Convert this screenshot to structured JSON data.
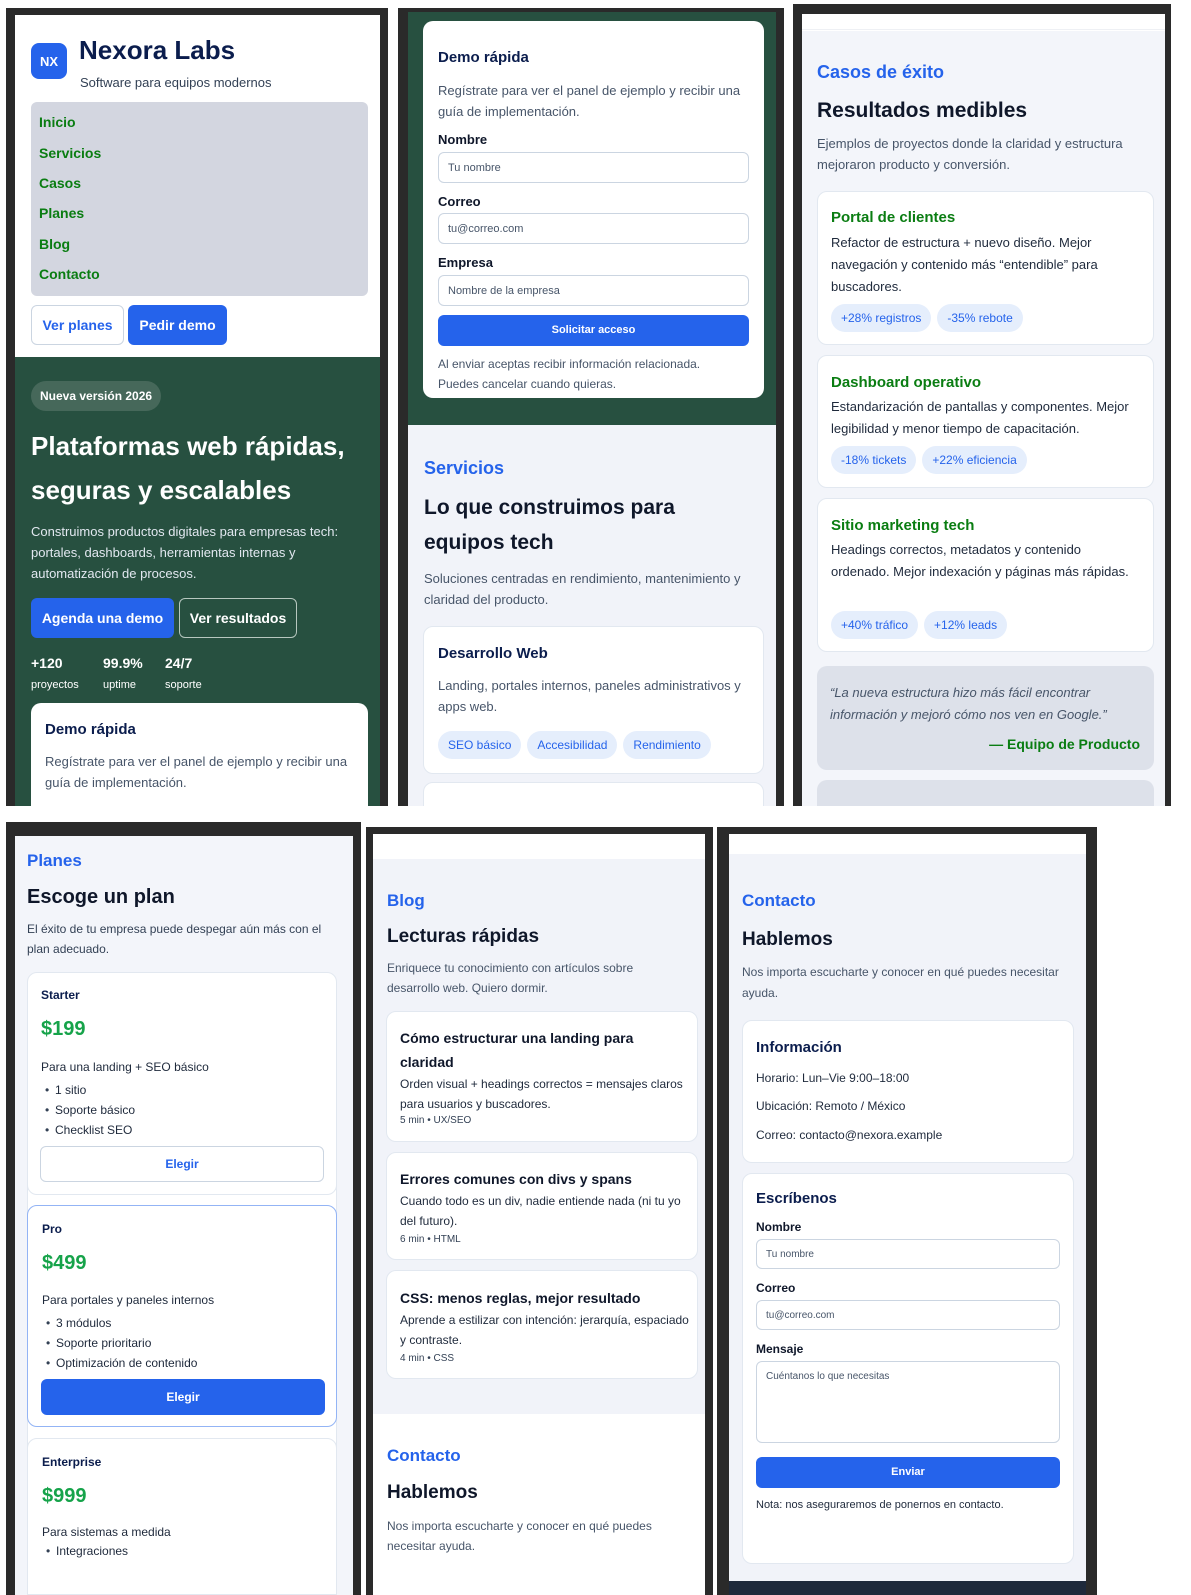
{
  "brand": {
    "badge": "NX",
    "name": "Nexora Labs",
    "tagline": "Software para equipos modernos"
  },
  "nav": [
    "Inicio",
    "Servicios",
    "Casos",
    "Planes",
    "Blog",
    "Contacto"
  ],
  "header_buttons": {
    "plans": "Ver planes",
    "demo": "Pedir demo"
  },
  "hero": {
    "badge": "Nueva versión 2026",
    "title_line1": "Plataformas web rápidas,",
    "title_line2": "seguras y escalables",
    "desc": "Construimos productos digitales para empresas tech: portales, dashboards, herramientas internas y automatización de procesos.",
    "cta_primary": "Agenda una demo",
    "cta_secondary": "Ver resultados",
    "stats": [
      {
        "value": "+120",
        "label": "proyectos"
      },
      {
        "value": "99.9%",
        "label": "uptime"
      },
      {
        "value": "24/7",
        "label": "soporte"
      }
    ]
  },
  "demo": {
    "title": "Demo rápida",
    "desc": "Regístrate para ver el panel de ejemplo y recibir una guía de implementación.",
    "name_label": "Nombre",
    "name_placeholder": "Tu nombre",
    "email_label": "Correo",
    "email_placeholder": "tu@correo.com",
    "company_label": "Empresa",
    "company_placeholder": "Nombre de la empresa",
    "submit": "Solicitar acceso",
    "note": "Al enviar aceptas recibir información relacionada. Puedes cancelar cuando quieras."
  },
  "services": {
    "eyebrow": "Servicios",
    "title_line1": "Lo que construimos para",
    "title_line2": "equipos tech",
    "desc": "Soluciones centradas en rendimiento, mantenimiento y claridad del producto.",
    "card": {
      "title": "Desarrollo Web",
      "desc": "Landing, portales internos, paneles administrativos y apps web.",
      "tags": [
        "SEO básico",
        "Accesibilidad",
        "Rendimiento"
      ]
    }
  },
  "cases": {
    "eyebrow": "Casos de éxito",
    "title": "Resultados medibles",
    "desc": "Ejemplos de proyectos donde la claridad y estructura mejoraron producto y conversión.",
    "items": [
      {
        "title": "Portal de clientes",
        "desc": "Refactor de estructura + nuevo diseño. Mejor navegación y contenido más “entendible” para buscadores.",
        "chips": [
          "+28% registros",
          "-35% rebote"
        ]
      },
      {
        "title": "Dashboard operativo",
        "desc": "Estandarización de pantallas y componentes. Mejor legibilidad y menor tiempo de capacitación.",
        "chips": [
          "-18% tickets",
          "+22% eficiencia"
        ]
      },
      {
        "title": "Sitio marketing tech",
        "desc": "Headings correctos, metadatos y contenido ordenado. Mejor indexación y páginas más rápidas.",
        "chips": [
          "+40% tráfico",
          "+12% leads"
        ]
      }
    ],
    "quote": "“La nueva estructura hizo más fácil encontrar información y mejoró cómo nos ven en Google.”",
    "quote_author": "— Equipo de Producto"
  },
  "plans": {
    "eyebrow": "Planes",
    "title": "Escoge un plan",
    "desc": "El éxito de tu empresa puede despegar aún más con el plan adecuado.",
    "items": [
      {
        "name": "Starter",
        "price": "$199",
        "desc": "Para una landing + SEO básico",
        "features": [
          "1 sitio",
          "Soporte básico",
          "Checklist SEO"
        ],
        "cta": "Elegir"
      },
      {
        "name": "Pro",
        "price": "$499",
        "desc": "Para portales y paneles internos",
        "features": [
          "3 módulos",
          "Soporte prioritario",
          "Optimización de contenido"
        ],
        "cta": "Elegir"
      },
      {
        "name": "Enterprise",
        "price": "$999",
        "desc": "Para sistemas a medida",
        "features": [
          "Integraciones"
        ]
      }
    ]
  },
  "blog": {
    "eyebrow": "Blog",
    "title": "Lecturas rápidas",
    "desc": "Enriquece tu conocimiento con artículos sobre desarrollo web. Quiero dormir.",
    "posts": [
      {
        "title": "Cómo estructurar una landing para claridad",
        "desc": "Orden visual + headings correctos = mensajes claros para usuarios y buscadores.",
        "meta": "5 min • UX/SEO"
      },
      {
        "title": "Errores comunes con divs y spans",
        "desc": "Cuando todo es un div, nadie entiende nada (ni tu yo del futuro).",
        "meta": "6 min • HTML"
      },
      {
        "title": "CSS: menos reglas, mejor resultado",
        "desc": "Aprende a estilizar con intención: jerarquía, espaciado y contraste.",
        "meta": "4 min • CSS"
      }
    ]
  },
  "contact": {
    "eyebrow": "Contacto",
    "title": "Hablemos",
    "desc": "Nos importa escucharte y conocer en qué puedes necesitar ayuda.",
    "info_title": "Información",
    "hours": "Horario: Lun–Vie 9:00–18:00",
    "location": "Ubicación: Remoto / México",
    "email": "Correo: contacto@nexora.example",
    "form_title": "Escríbenos",
    "name_label": "Nombre",
    "name_placeholder": "Tu nombre",
    "email_label": "Correo",
    "email_placeholder": "tu@correo.com",
    "message_label": "Mensaje",
    "message_placeholder": "Cuéntanos lo que necesitas",
    "submit": "Enviar",
    "note": "Nota: nos aseguraremos de ponernos en contacto."
  },
  "colors": {
    "accent": "#2563eb",
    "hero_bg": "#275040",
    "green_text": "#0a7d12",
    "price": "#16a34a"
  }
}
